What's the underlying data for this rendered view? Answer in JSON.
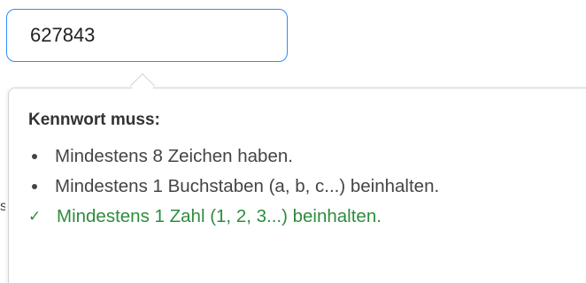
{
  "password_field": {
    "value": "627843"
  },
  "partial_text": "s",
  "requirements": {
    "title": "Kennwort muss:",
    "items": [
      {
        "text": "Mindestens 8 Zeichen haben.",
        "status": "unmet",
        "icon": "bullet-icon"
      },
      {
        "text": "Mindestens 1 Buchstaben (a, b, c...) beinhalten.",
        "status": "unmet",
        "icon": "bullet-icon"
      },
      {
        "text": "Mindestens 1 Zahl (1, 2, 3...) beinhalten.",
        "status": "met",
        "icon": "check-icon"
      }
    ]
  },
  "colors": {
    "input_focus_border": "#2d8cff",
    "met_requirement": "#2d8c3c",
    "unmet_requirement": "#444444"
  }
}
